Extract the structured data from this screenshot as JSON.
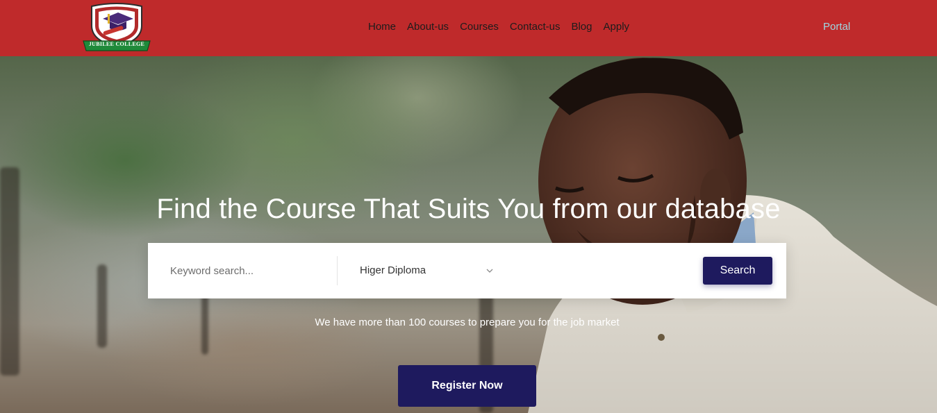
{
  "header": {
    "logo_text": "JUBILEE COLLEGE",
    "nav": [
      {
        "label": "Home"
      },
      {
        "label": "About-us"
      },
      {
        "label": "Courses"
      },
      {
        "label": "Contact-us"
      },
      {
        "label": "Blog"
      },
      {
        "label": "Apply"
      }
    ],
    "portal_label": "Portal"
  },
  "hero": {
    "title": "Find the Course That Suits You from our database",
    "search": {
      "keyword_placeholder": "Keyword search...",
      "keyword_value": "",
      "selected_program": "Higer Diploma",
      "search_label": "Search"
    },
    "subtext": "We have more than 100 courses to prepare you for the job market",
    "register_label": "Register Now"
  },
  "colors": {
    "header_bg": "#bf2a2b",
    "button_bg": "#1e1a5e",
    "portal_link": "#9dd8e3"
  },
  "icons": {
    "logo": "college-crest-icon",
    "dropdown": "chevron-down-icon"
  }
}
